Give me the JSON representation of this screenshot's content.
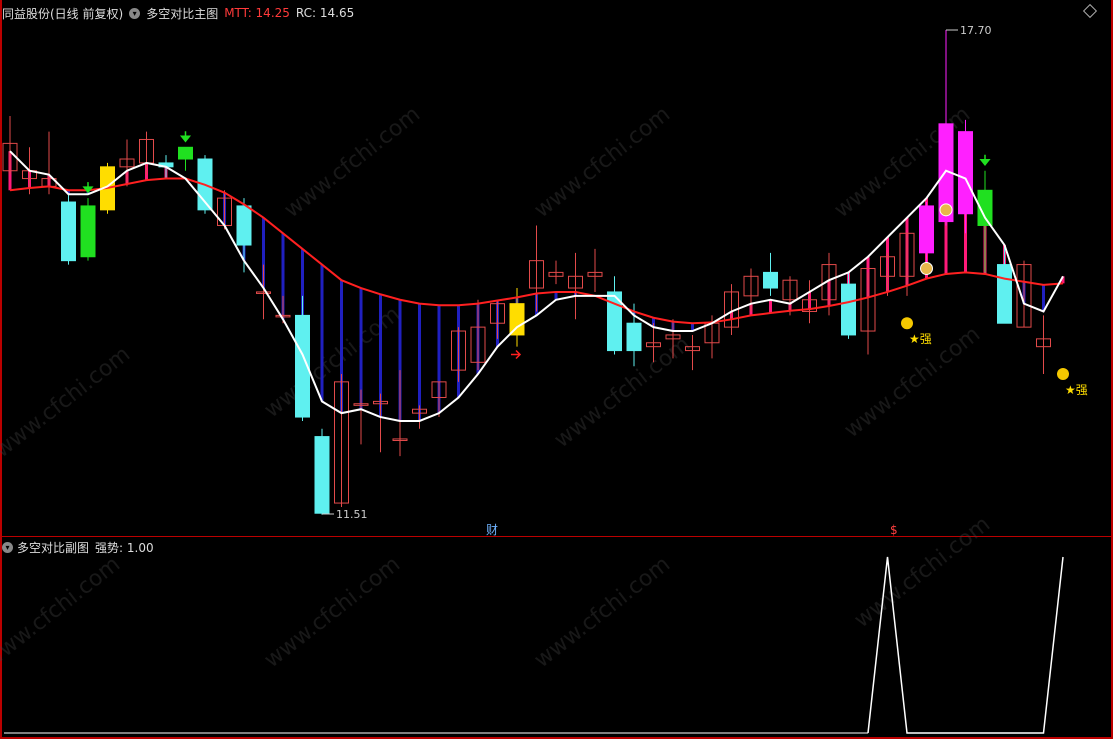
{
  "header": {
    "stock": "同益股份(日线 前复权)",
    "indicator": "多空对比主图",
    "mtt_label": "MTT: 14.25",
    "rc_label": "RC: 14.65"
  },
  "subpanel": {
    "title": "多空对比副图",
    "strength_label": "强势: 1.00"
  },
  "annotations": {
    "high_label": "17.70",
    "low_label": "11.51",
    "cai_marker": "财",
    "dollar_marker": "$",
    "strong_label_1": "★强",
    "strong_label_2": "★强"
  },
  "watermark": "www.cfchi.com",
  "colors": {
    "up_candle": "#e24a4a",
    "down_candle": "#5ff0f0",
    "white_line": "#ffffff",
    "red_line": "#ff2020",
    "fill_pink": "#ff1a7a",
    "fill_blue": "#2020c0",
    "magenta": "#ff20ff",
    "yellow": "#ffdd00",
    "green": "#20e020"
  },
  "chart_data": {
    "type": "candlestick",
    "price_high": 17.7,
    "price_low": 11.51,
    "candles": [
      [
        15.9,
        16.6,
        15.85,
        16.25
      ],
      [
        15.8,
        16.2,
        15.6,
        15.9
      ],
      [
        15.7,
        16.4,
        15.6,
        15.8
      ],
      [
        15.5,
        15.6,
        14.7,
        14.75
      ],
      [
        14.8,
        15.55,
        14.75,
        15.45
      ],
      [
        15.4,
        16.0,
        15.35,
        15.95
      ],
      [
        15.95,
        16.3,
        15.7,
        16.05
      ],
      [
        16.0,
        16.4,
        15.85,
        16.3
      ],
      [
        16.0,
        16.1,
        15.8,
        15.95
      ],
      [
        16.05,
        16.2,
        15.9,
        16.2
      ],
      [
        16.05,
        16.1,
        15.35,
        15.4
      ],
      [
        15.2,
        15.65,
        15.15,
        15.55
      ],
      [
        15.45,
        15.55,
        14.6,
        14.95
      ],
      [
        14.35,
        14.7,
        14.0,
        14.35
      ],
      [
        14.05,
        14.3,
        13.95,
        14.05
      ],
      [
        14.05,
        14.3,
        12.7,
        12.75
      ],
      [
        12.5,
        12.6,
        11.5,
        11.52
      ],
      [
        11.65,
        13.3,
        11.6,
        13.2
      ],
      [
        12.9,
        13.1,
        12.4,
        12.92
      ],
      [
        12.92,
        13.05,
        12.3,
        12.95
      ],
      [
        12.45,
        13.35,
        12.25,
        12.47
      ],
      [
        12.8,
        12.9,
        12.6,
        12.85
      ],
      [
        13.0,
        13.2,
        12.75,
        13.2
      ],
      [
        13.35,
        13.9,
        13.2,
        13.85
      ],
      [
        13.45,
        14.25,
        13.35,
        13.9
      ],
      [
        13.95,
        14.25,
        13.75,
        14.2
      ],
      [
        13.8,
        14.4,
        13.65,
        14.2
      ],
      [
        14.4,
        15.2,
        14.1,
        14.75
      ],
      [
        14.55,
        14.75,
        14.45,
        14.6
      ],
      [
        14.4,
        14.85,
        14.0,
        14.55
      ],
      [
        14.55,
        14.9,
        14.35,
        14.6
      ],
      [
        14.35,
        14.55,
        13.55,
        13.6
      ],
      [
        13.95,
        14.2,
        13.4,
        13.6
      ],
      [
        13.65,
        13.95,
        13.45,
        13.7
      ],
      [
        13.75,
        14.0,
        13.5,
        13.8
      ],
      [
        13.6,
        13.8,
        13.35,
        13.65
      ],
      [
        13.7,
        14.05,
        13.5,
        13.95
      ],
      [
        13.9,
        14.45,
        13.8,
        14.35
      ],
      [
        14.3,
        14.65,
        14.1,
        14.55
      ],
      [
        14.6,
        14.85,
        14.3,
        14.4
      ],
      [
        14.25,
        14.55,
        14.05,
        14.5
      ],
      [
        14.1,
        14.5,
        13.95,
        14.25
      ],
      [
        14.25,
        14.85,
        14.05,
        14.7
      ],
      [
        14.45,
        14.6,
        13.75,
        13.8
      ],
      [
        13.85,
        14.6,
        13.55,
        14.65
      ],
      [
        14.55,
        14.85,
        14.3,
        14.8
      ],
      [
        14.55,
        15.1,
        14.3,
        15.1
      ],
      [
        14.85,
        15.5,
        14.65,
        15.45
      ],
      [
        15.25,
        17.7,
        15.2,
        16.5
      ],
      [
        16.4,
        16.55,
        15.1,
        15.35
      ],
      [
        15.2,
        15.9,
        14.6,
        15.65
      ],
      [
        14.7,
        14.95,
        13.95,
        13.95
      ],
      [
        13.9,
        14.75,
        13.9,
        14.7
      ],
      [
        13.65,
        14.05,
        13.3,
        13.75
      ]
    ],
    "white_line": [
      16.15,
      15.9,
      15.85,
      15.6,
      15.6,
      15.7,
      15.9,
      16.0,
      15.95,
      15.8,
      15.5,
      15.2,
      14.75,
      14.4,
      14.0,
      13.55,
      12.95,
      12.8,
      12.85,
      12.75,
      12.7,
      12.7,
      12.8,
      13.0,
      13.3,
      13.65,
      13.9,
      14.05,
      14.25,
      14.3,
      14.3,
      14.3,
      14.05,
      13.9,
      13.85,
      13.85,
      13.95,
      14.1,
      14.2,
      14.25,
      14.2,
      14.35,
      14.5,
      14.6,
      14.8,
      15.05,
      15.3,
      15.55,
      15.9,
      15.8,
      15.3,
      14.95,
      14.2,
      14.1,
      14.55
    ],
    "red_line": [
      15.65,
      15.68,
      15.7,
      15.65,
      15.65,
      15.68,
      15.73,
      15.78,
      15.8,
      15.8,
      15.72,
      15.62,
      15.47,
      15.3,
      15.1,
      14.9,
      14.7,
      14.5,
      14.4,
      14.32,
      14.25,
      14.2,
      14.18,
      14.18,
      14.2,
      14.24,
      14.28,
      14.33,
      14.35,
      14.35,
      14.3,
      14.2,
      14.1,
      14.02,
      13.97,
      13.95,
      13.96,
      14.0,
      14.05,
      14.08,
      14.11,
      14.13,
      14.17,
      14.22,
      14.28,
      14.35,
      14.43,
      14.52,
      14.58,
      14.6,
      14.58,
      14.52,
      14.48,
      14.44,
      14.46
    ],
    "sub_series": {
      "name": "强势",
      "values": [
        0,
        0,
        0,
        0,
        0,
        0,
        0,
        0,
        0,
        0,
        0,
        0,
        0,
        0,
        0,
        0,
        0,
        0,
        0,
        0,
        0,
        0,
        0,
        0,
        0,
        0,
        0,
        0,
        0,
        0,
        0,
        0,
        0,
        0,
        0,
        0,
        0,
        0,
        0,
        0,
        0,
        0,
        0,
        0,
        0,
        1,
        0,
        0,
        0,
        0,
        0,
        0,
        0,
        0,
        1
      ]
    }
  }
}
